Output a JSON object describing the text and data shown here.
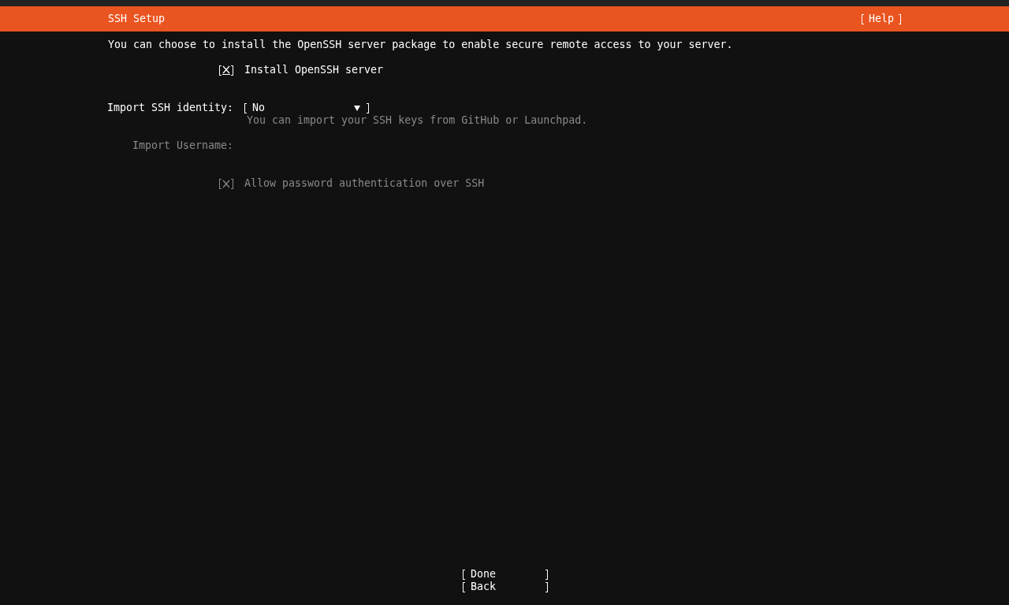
{
  "header": {
    "title": "SSH Setup",
    "help_button": "Help"
  },
  "description": "You can choose to install the OpenSSH server package to enable secure remote access to your server.",
  "install_openssh": {
    "label": "Install OpenSSH server",
    "checked": true,
    "disabled": false,
    "focused": true
  },
  "import_identity": {
    "label": "Import SSH identity:",
    "value": "No",
    "hint": "You can import your SSH keys from GitHub or Launchpad."
  },
  "import_username": {
    "label": "Import Username:",
    "disabled": true
  },
  "allow_password": {
    "label": "Allow password authentication over SSH",
    "checked": true,
    "disabled": true,
    "focused": false
  },
  "buttons": [
    {
      "label": "Done"
    },
    {
      "label": "Back"
    }
  ]
}
